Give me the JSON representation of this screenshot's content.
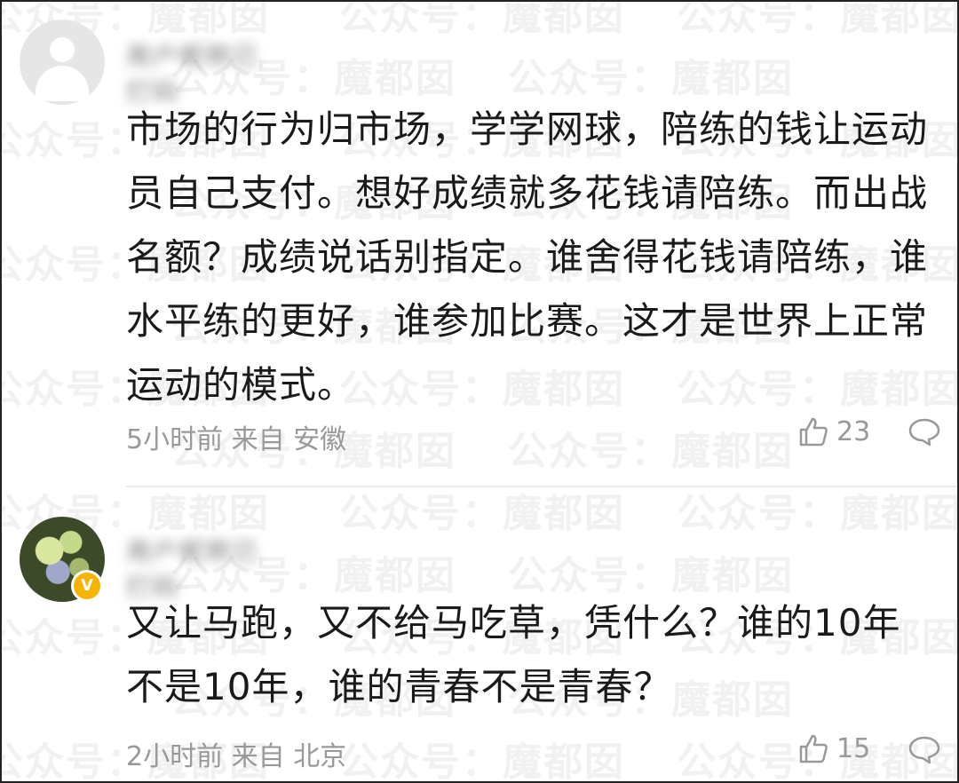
{
  "watermark": {
    "text": "公众号：魔都囡"
  },
  "comments": [
    {
      "username": "用户昵称已打码",
      "text": "市场的行为归市场，学学网球，陪练的钱让运动员自己支付。想好成绩就多花钱请陪练。而出战名额？成绩说话别指定。谁舍得花钱请陪练，谁水平练的更好，谁参加比赛。这才是世界上正常运动的模式。",
      "time": "5小时前",
      "from_label": "来自",
      "location": "安徽",
      "likes": "23"
    },
    {
      "username": "用户昵称已打码",
      "badge": "V",
      "text": "又让马跑，又不给马吃草，凭什么？谁的10年不是10年，谁的青春不是青春？",
      "time": "2小时前",
      "from_label": "来自",
      "location": "北京",
      "likes": "15"
    }
  ],
  "icons": {
    "like": "thumbs-up-icon",
    "reply": "speech-bubble-icon"
  },
  "colors": {
    "text": "#1a1a1a",
    "meta": "#999999",
    "badge": "#f6b400",
    "watermark": "#f1f1f1"
  }
}
